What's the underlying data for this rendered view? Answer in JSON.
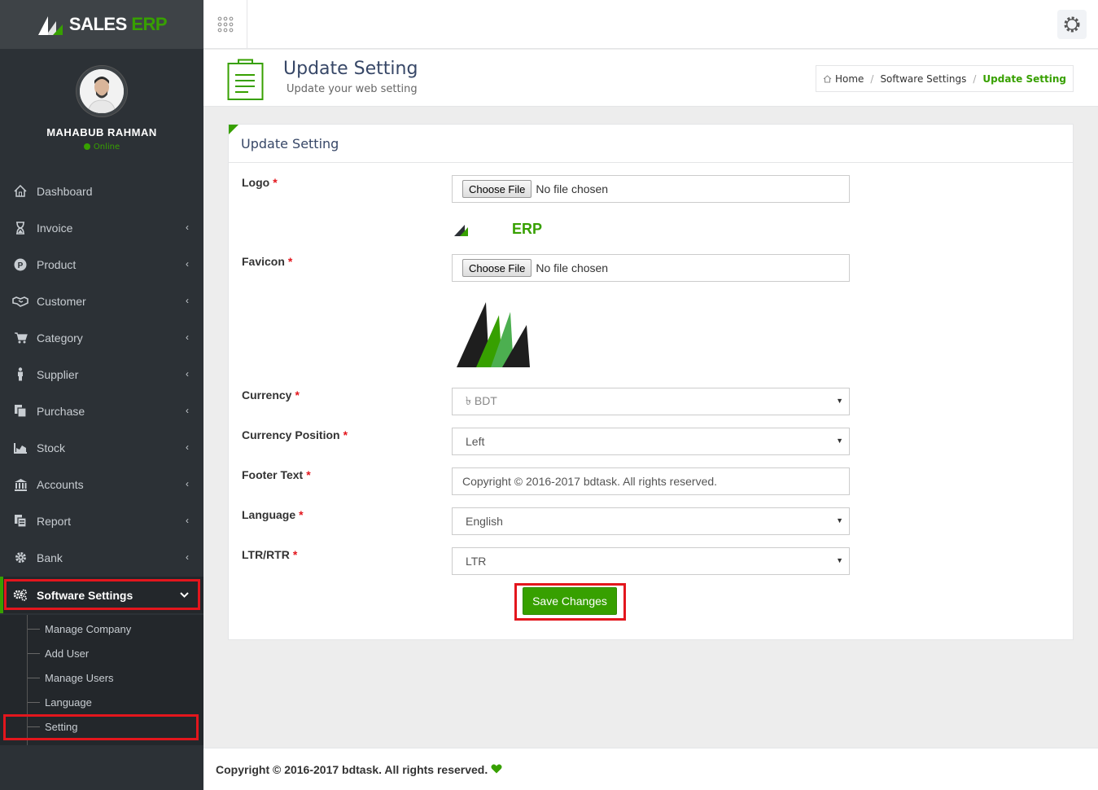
{
  "brand": {
    "name_part1": "SALES ",
    "name_part2": "ERP"
  },
  "profile": {
    "name": "MAHABUB RAHMAN",
    "status": "Online"
  },
  "sidebar": {
    "items": [
      {
        "label": "Dashboard",
        "icon": "home-icon"
      },
      {
        "label": "Invoice",
        "icon": "hourglass-icon"
      },
      {
        "label": "Product",
        "icon": "product-p-icon"
      },
      {
        "label": "Customer",
        "icon": "handshake-icon"
      },
      {
        "label": "Category",
        "icon": "cart-icon"
      },
      {
        "label": "Supplier",
        "icon": "person-icon"
      },
      {
        "label": "Purchase",
        "icon": "copy-icon"
      },
      {
        "label": "Stock",
        "icon": "chart-icon"
      },
      {
        "label": "Accounts",
        "icon": "bank-icon"
      },
      {
        "label": "Report",
        "icon": "report-icon"
      },
      {
        "label": "Bank",
        "icon": "gear-icon"
      },
      {
        "label": "Software Settings",
        "icon": "gears-icon"
      }
    ],
    "submenu": [
      "Manage Company",
      "Add User",
      "Manage Users",
      "Language",
      "Setting"
    ]
  },
  "page_header": {
    "title": "Update Setting",
    "subtitle": "Update your web setting"
  },
  "breadcrumb": {
    "home": "Home",
    "parent": "Software Settings",
    "current": "Update Setting"
  },
  "panel": {
    "title": "Update Setting",
    "logo": {
      "label": "Logo",
      "button": "Choose File",
      "status": "No file chosen",
      "preview_text": "ERP"
    },
    "favicon": {
      "label": "Favicon",
      "button": "Choose File",
      "status": "No file chosen"
    },
    "currency": {
      "label": "Currency",
      "value": "৳ BDT"
    },
    "currency_position": {
      "label": "Currency Position",
      "value": "Left"
    },
    "footer_text": {
      "label": "Footer Text",
      "value": "Copyright © 2016-2017 bdtask. All rights reserved."
    },
    "language": {
      "label": "Language",
      "value": "English"
    },
    "direction": {
      "label": "LTR/RTR",
      "value": "LTR"
    },
    "required_mark": "*",
    "save_label": "Save Changes"
  },
  "footer": {
    "text": "Copyright © 2016-2017 bdtask. All rights reserved."
  },
  "colors": {
    "accent": "#37a000",
    "sidebar": "#2c3136",
    "highlight": "#e3161d"
  }
}
